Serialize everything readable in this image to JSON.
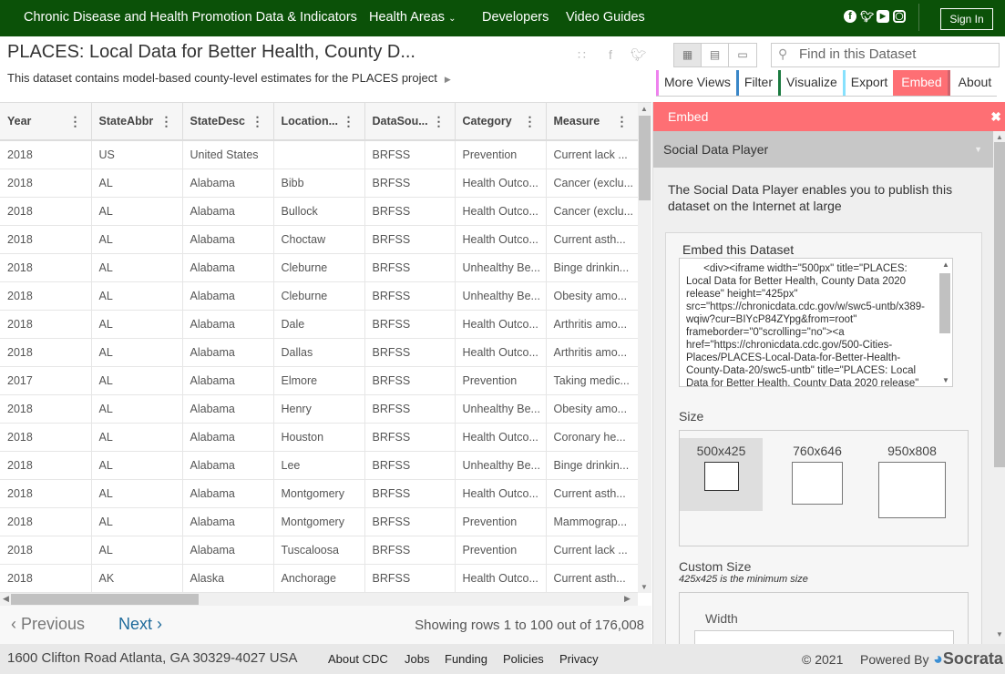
{
  "topbar": {
    "site_title": "Chronic Disease and Health Promotion Data & Indicators",
    "nav": [
      {
        "label": "Health Areas",
        "has_dropdown": true
      },
      {
        "label": "Developers"
      },
      {
        "label": "Video Guides"
      }
    ],
    "social_icons": [
      "facebook-icon",
      "twitter-icon",
      "youtube-icon",
      "instagram-icon"
    ],
    "sign_in": "Sign In"
  },
  "dataset": {
    "title": "PLACES: Local Data for Better Health, County D...",
    "description": "This dataset contains model-based county-level estimates for the PLACES project",
    "share_icons": [
      "rss-icon",
      "facebook-icon",
      "twitter-icon"
    ]
  },
  "view_switcher": [
    "grid-view-icon",
    "card-view-icon",
    "single-row-view-icon"
  ],
  "search": {
    "placeholder": "Find in this Dataset",
    "value": ""
  },
  "tabs": [
    {
      "label": "More Views",
      "accent": "#ee82ee"
    },
    {
      "label": "Filter",
      "accent": "#3a87c8"
    },
    {
      "label": "Visualize",
      "accent": "#1a7a3f"
    },
    {
      "label": "Export",
      "accent": "#87e1fd"
    },
    {
      "label": "Embed",
      "accent": "#d0636c",
      "active": true
    },
    {
      "label": "About",
      "accent": ""
    }
  ],
  "table": {
    "columns": [
      "Year",
      "StateAbbr",
      "StateDesc",
      "Location...",
      "DataSou...",
      "Category",
      "Measure"
    ],
    "rows": [
      [
        "2018",
        "US",
        "United States",
        "",
        "BRFSS",
        "Prevention",
        "Current lack ..."
      ],
      [
        "2018",
        "AL",
        "Alabama",
        "Bibb",
        "BRFSS",
        "Health Outco...",
        "Cancer (exclu..."
      ],
      [
        "2018",
        "AL",
        "Alabama",
        "Bullock",
        "BRFSS",
        "Health Outco...",
        "Cancer (exclu..."
      ],
      [
        "2018",
        "AL",
        "Alabama",
        "Choctaw",
        "BRFSS",
        "Health Outco...",
        "Current asth..."
      ],
      [
        "2018",
        "AL",
        "Alabama",
        "Cleburne",
        "BRFSS",
        "Unhealthy Be...",
        "Binge drinkin..."
      ],
      [
        "2018",
        "AL",
        "Alabama",
        "Cleburne",
        "BRFSS",
        "Unhealthy Be...",
        "Obesity amo..."
      ],
      [
        "2018",
        "AL",
        "Alabama",
        "Dale",
        "BRFSS",
        "Health Outco...",
        "Arthritis amo..."
      ],
      [
        "2018",
        "AL",
        "Alabama",
        "Dallas",
        "BRFSS",
        "Health Outco...",
        "Arthritis amo..."
      ],
      [
        "2017",
        "AL",
        "Alabama",
        "Elmore",
        "BRFSS",
        "Prevention",
        "Taking medic..."
      ],
      [
        "2018",
        "AL",
        "Alabama",
        "Henry",
        "BRFSS",
        "Unhealthy Be...",
        "Obesity amo..."
      ],
      [
        "2018",
        "AL",
        "Alabama",
        "Houston",
        "BRFSS",
        "Health Outco...",
        "Coronary he..."
      ],
      [
        "2018",
        "AL",
        "Alabama",
        "Lee",
        "BRFSS",
        "Unhealthy Be...",
        "Binge drinkin..."
      ],
      [
        "2018",
        "AL",
        "Alabama",
        "Montgomery",
        "BRFSS",
        "Health Outco...",
        "Current asth..."
      ],
      [
        "2018",
        "AL",
        "Alabama",
        "Montgomery",
        "BRFSS",
        "Prevention",
        "Mammograp..."
      ],
      [
        "2018",
        "AL",
        "Alabama",
        "Tuscaloosa",
        "BRFSS",
        "Prevention",
        "Current lack ..."
      ],
      [
        "2018",
        "AK",
        "Alaska",
        "Anchorage",
        "BRFSS",
        "Health Outco...",
        "Current asth..."
      ]
    ]
  },
  "pager": {
    "previous": "Previous",
    "next": "Next",
    "status": "Showing rows 1 to 100 out of 176,008"
  },
  "panel": {
    "title": "Embed",
    "section": "Social Data Player",
    "intro": "The Social Data Player enables you to publish this dataset on the Internet at large",
    "embed_label": "Embed this Dataset",
    "embed_code": "      <div><iframe width=\"500px\" title=\"PLACES: Local Data for Better Health, County Data 2020 release\" height=\"425px\" src=\"https://chronicdata.cdc.gov/w/swc5-untb/x389-wqiw?cur=BIYcP84ZYpg&from=root\" frameborder=\"0\"scrolling=\"no\"><a href=\"https://chronicdata.cdc.gov/500-Cities-Places/PLACES-Local-Data-for-Better-Health-County-Data-20/swc5-untb\" title=\"PLACES: Local Data for Better Health, County Data 2020 release\"",
    "size_label": "Size",
    "sizes": [
      {
        "label": "500x425",
        "selected": true
      },
      {
        "label": "760x646"
      },
      {
        "label": "950x808"
      }
    ],
    "custom_label": "Custom Size",
    "custom_note": "425x425 is the minimum size",
    "width_label": "Width"
  },
  "footer": {
    "address": "1600 Clifton Road Atlanta, GA 30329-4027 USA",
    "links": [
      "About CDC",
      "Jobs",
      "Funding",
      "Policies",
      "Privacy"
    ],
    "copyright": "© 2021",
    "powered_by": "Powered By",
    "brand": "Socrata"
  }
}
